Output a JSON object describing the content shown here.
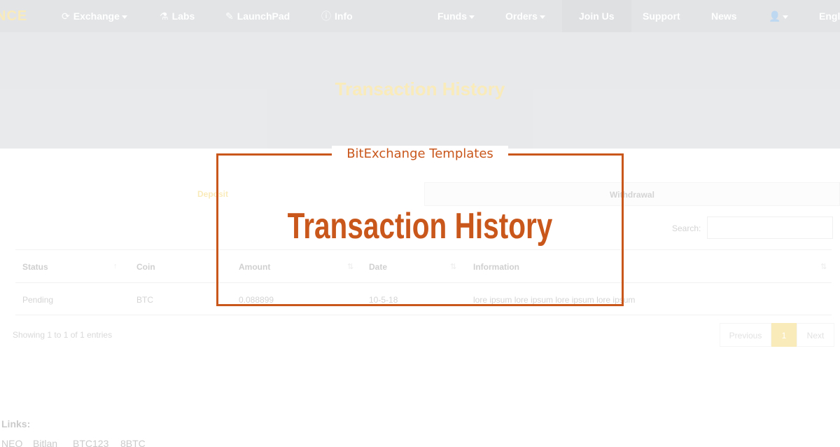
{
  "navbar": {
    "brand": "NCE",
    "items": [
      {
        "label": "Exchange",
        "icon": "refresh-icon",
        "dropdown": true
      },
      {
        "label": "Labs",
        "icon": "flask-icon",
        "dropdown": false
      },
      {
        "label": "LaunchPad",
        "icon": "rocket-icon",
        "dropdown": false
      },
      {
        "label": "Info",
        "icon": "info-icon",
        "dropdown": false
      },
      {
        "label": "Funds",
        "dropdown": true
      },
      {
        "label": "Orders",
        "dropdown": true
      },
      {
        "label": "Join Us",
        "dropdown": false
      },
      {
        "label": "Support",
        "dropdown": false
      },
      {
        "label": "News",
        "dropdown": false
      },
      {
        "label": "Engl",
        "dropdown": false
      }
    ]
  },
  "hero": {
    "title": "Transaction History"
  },
  "tabs": [
    {
      "label": "Deposit"
    },
    {
      "label": "Withdrawal"
    }
  ],
  "search": {
    "label": "Search:",
    "value": ""
  },
  "table": {
    "columns": [
      "Status",
      "Coin",
      "Amount",
      "Date",
      "Information"
    ],
    "rows": [
      {
        "status": "Pending",
        "coin": "BTC",
        "amount": "0.088899",
        "date": "10-5-18",
        "information": "lore ipsum lore ipsum lore ipsum lore ipsum"
      }
    ]
  },
  "table_info": "Showing 1 to 1 of 1 entries",
  "pagination": {
    "previous": "Previous",
    "page": "1",
    "next": "Next"
  },
  "footer": {
    "links_label": "Links:",
    "links": [
      "NEO",
      "Bitlan",
      "BTC123",
      "8BTC"
    ]
  },
  "overlay": {
    "caption": "BitExchange Templates",
    "title": "Transaction History"
  },
  "colors": {
    "accent": "#f0b90b",
    "overlay": "#c9571c",
    "navbar": "#9aa1a8"
  }
}
